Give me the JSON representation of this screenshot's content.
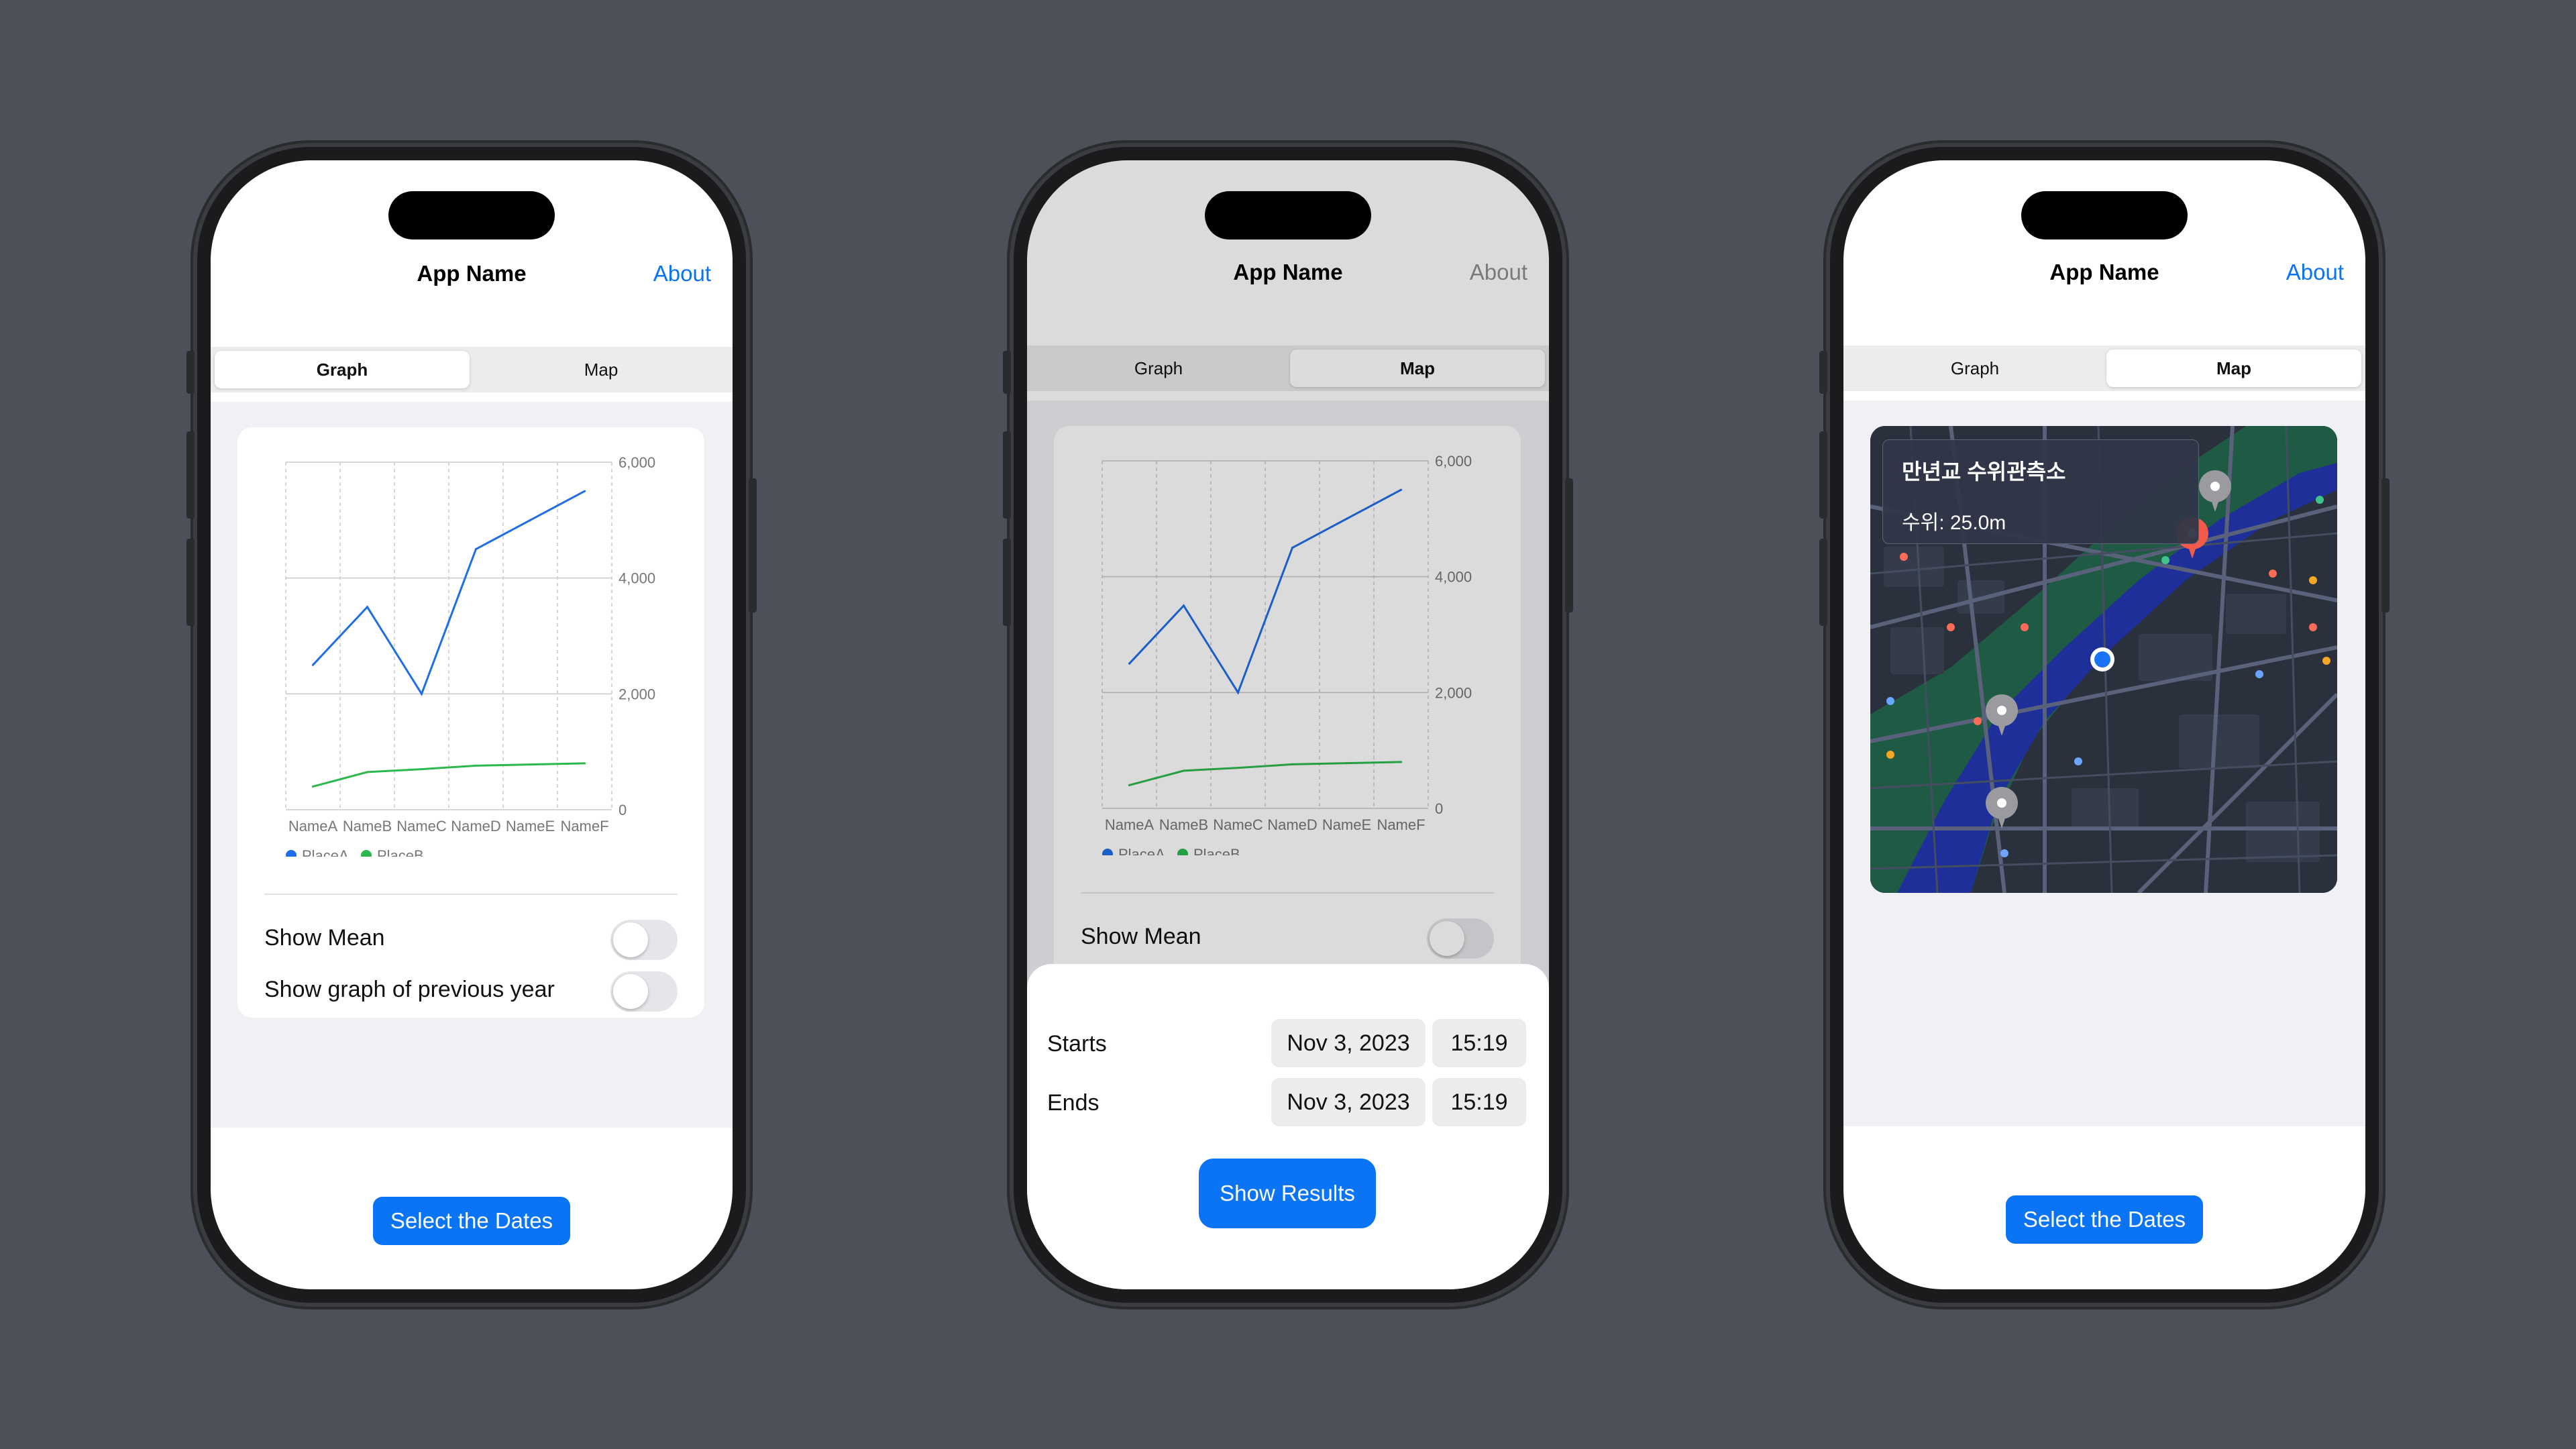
{
  "app": {
    "title": "App Name",
    "about_label": "About"
  },
  "tabs": {
    "graph": "Graph",
    "map": "Map"
  },
  "chart_data": {
    "type": "line",
    "categories": [
      "NameA",
      "NameB",
      "NameC",
      "NameD",
      "NameE",
      "NameF"
    ],
    "series": [
      {
        "name": "PlaceA",
        "color": "#1f6ee8",
        "values": [
          [
            0,
            2500
          ],
          [
            1,
            3500
          ],
          [
            2,
            2000
          ],
          [
            3,
            4500
          ],
          [
            4,
            5000
          ],
          [
            5,
            5500
          ]
        ]
      },
      {
        "name": "PlaceB",
        "color": "#2db84d",
        "values": [
          [
            0,
            400
          ],
          [
            1,
            650
          ],
          [
            2,
            700
          ],
          [
            3,
            760
          ],
          [
            4,
            780
          ],
          [
            5,
            800
          ]
        ]
      }
    ],
    "ylim": [
      0,
      6000
    ],
    "yticks": [
      "0",
      "2,000",
      "4,000",
      "6,000"
    ],
    "ytick_values": [
      0,
      2000,
      4000,
      6000
    ],
    "grid": true,
    "legend": "bottom-left"
  },
  "toggles": {
    "show_mean": "Show Mean",
    "show_prev_year": "Show graph of previous year"
  },
  "dates": {
    "starts_label": "Starts",
    "starts_date": "Nov 3, 2023",
    "starts_time": "15:19",
    "ends_label": "Ends",
    "ends_date": "Nov 3, 2023",
    "ends_time": "15:19",
    "show_results": "Show Results"
  },
  "select_dates": "Select the Dates",
  "map": {
    "station_name": "만년교 수위관측소",
    "water_level": "수위: 25.0m"
  }
}
